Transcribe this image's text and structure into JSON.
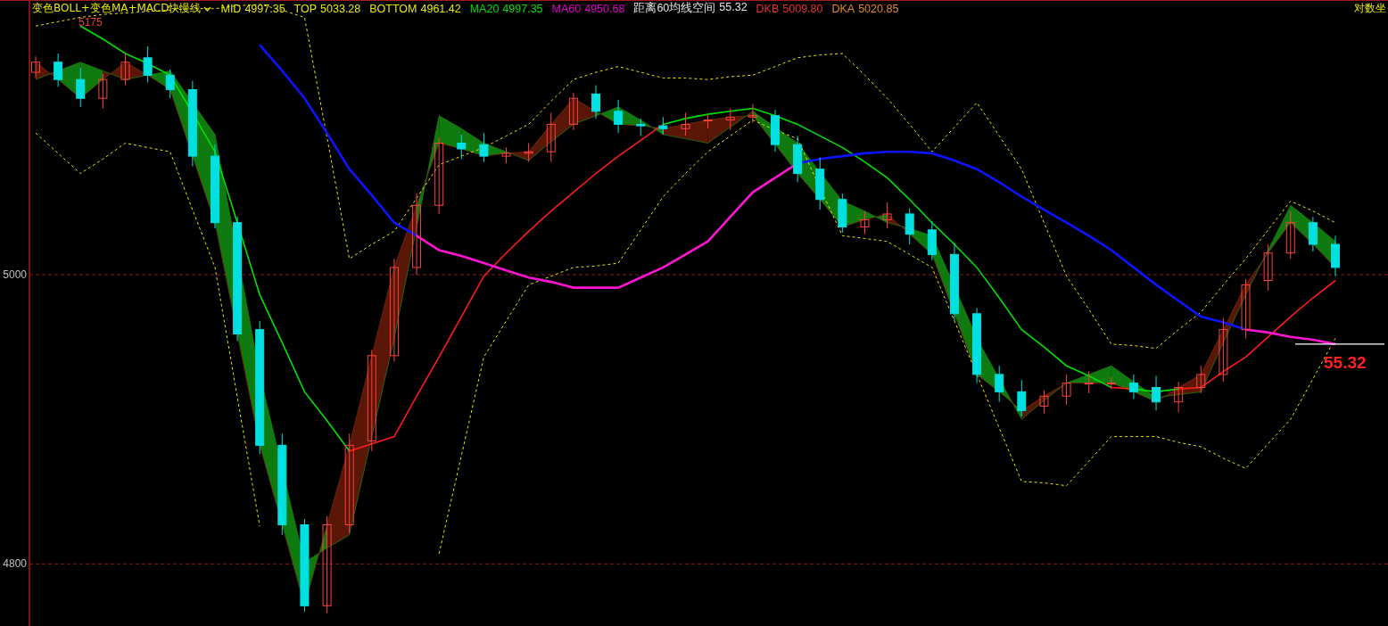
{
  "indicator": {
    "title": "变色BOLL+变色MA+MACD快慢线"
  },
  "readouts": [
    {
      "label": "MID",
      "value": "4997.35",
      "color": "#e8e800"
    },
    {
      "label": "TOP",
      "value": "5033.28",
      "color": "#e8e800"
    },
    {
      "label": "BOTTOM",
      "value": "4961.42",
      "color": "#e8e800"
    },
    {
      "label": "MA20",
      "value": "4997.35",
      "color": "#00e000"
    },
    {
      "label": "MA60",
      "value": "4950.68",
      "color": "#e000c8"
    },
    {
      "label": "距离60均线空间",
      "value": "55.32",
      "color": "#e6e6e6"
    },
    {
      "label": "DKB",
      "value": "5009.80",
      "color": "#e83030"
    },
    {
      "label": "DKA",
      "value": "5020.85",
      "color": "#e08a20"
    }
  ],
  "scale_toggle": "对数坐",
  "chart": {
    "y_labels": [
      "5000",
      "4800"
    ],
    "high_label": "5175",
    "gap_label": "55.32"
  }
}
